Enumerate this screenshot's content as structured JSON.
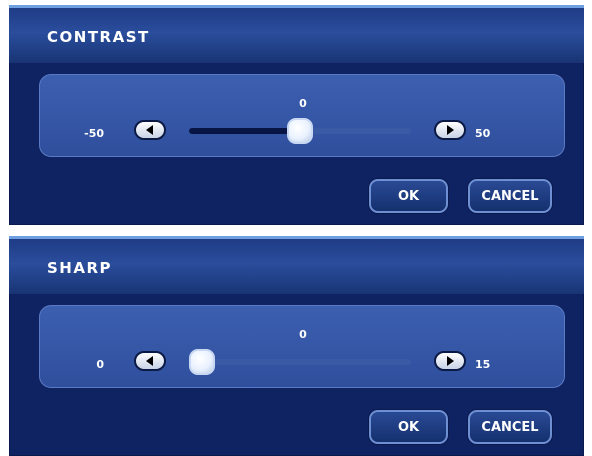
{
  "dialogs": [
    {
      "title": "CONTRAST",
      "value": "0",
      "min_label": "-50",
      "max_label": "50",
      "min": -50,
      "max": 50,
      "current": 0,
      "ok_label": "OK",
      "cancel_label": "CANCEL"
    },
    {
      "title": "SHARP",
      "value": "0",
      "min_label": "0",
      "max_label": "15",
      "min": 0,
      "max": 15,
      "current": 0,
      "ok_label": "OK",
      "cancel_label": "CANCEL"
    }
  ],
  "colors": {
    "background": "#0f2262",
    "panel": "#3d5fb0",
    "track": "#3b5aa6",
    "track_fill": "#081544",
    "text": "#ffffff"
  },
  "icons": {
    "decrease": "left-arrow-icon",
    "increase": "right-arrow-icon"
  }
}
